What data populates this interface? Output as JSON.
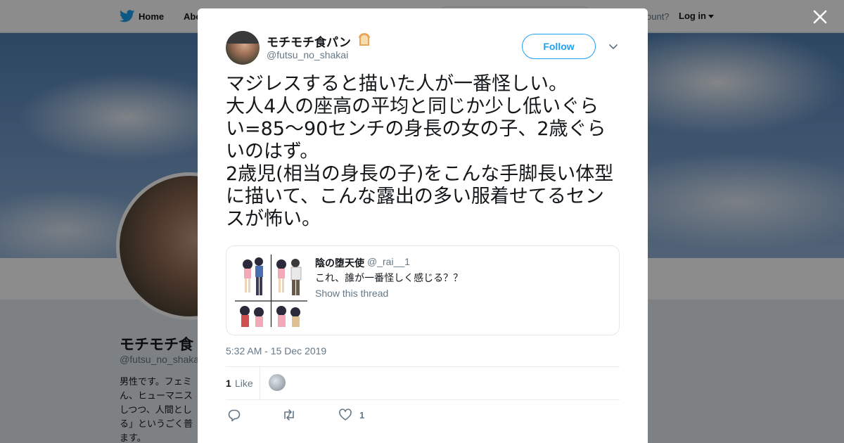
{
  "nav": {
    "home": "Home",
    "about": "Abo",
    "account_prompt": "ccount?",
    "login": "Log in"
  },
  "profile": {
    "name": "モチモチ食",
    "handle": "@futsu_no_shakai",
    "bio": "男性です。フェミ\nん、ヒューマニス\nしつつ、人間とし\nる」というごく普\nます。"
  },
  "tweet": {
    "author_name": "モチモチ食パン",
    "author_emoji": "bread-icon",
    "author_handle": "@futsu_no_shakai",
    "follow_label": "Follow",
    "text": "マジレスすると描いた人が一番怪しい。\n大人4人の座高の平均と同じか少し低いぐら\nい=85〜90センチの身長の女の子、2歳ぐら\nいのはず。\n2歳児(相当の身長の子)をこんな手脚長い体型\nに描いて、こんな露出の多い服着せてるセン\nスが怖い。",
    "timestamp": "5:32 AM - 15 Dec 2019",
    "likes_count": "1",
    "likes_label": "Like",
    "action_like_count": "1"
  },
  "quoted": {
    "name": "陰の堕天使",
    "handle": "@_rai__1",
    "text": "これ、誰が一番怪しく感じる？？",
    "thread_link": "Show this thread"
  },
  "colors": {
    "accent": "#1da1f2",
    "text_primary": "#14171a",
    "text_secondary": "#657786",
    "border": "#e1e8ed"
  },
  "icons": [
    "twitter-bird-icon",
    "close-icon",
    "chevron-down-icon",
    "reply-icon",
    "retweet-icon",
    "heart-icon"
  ]
}
